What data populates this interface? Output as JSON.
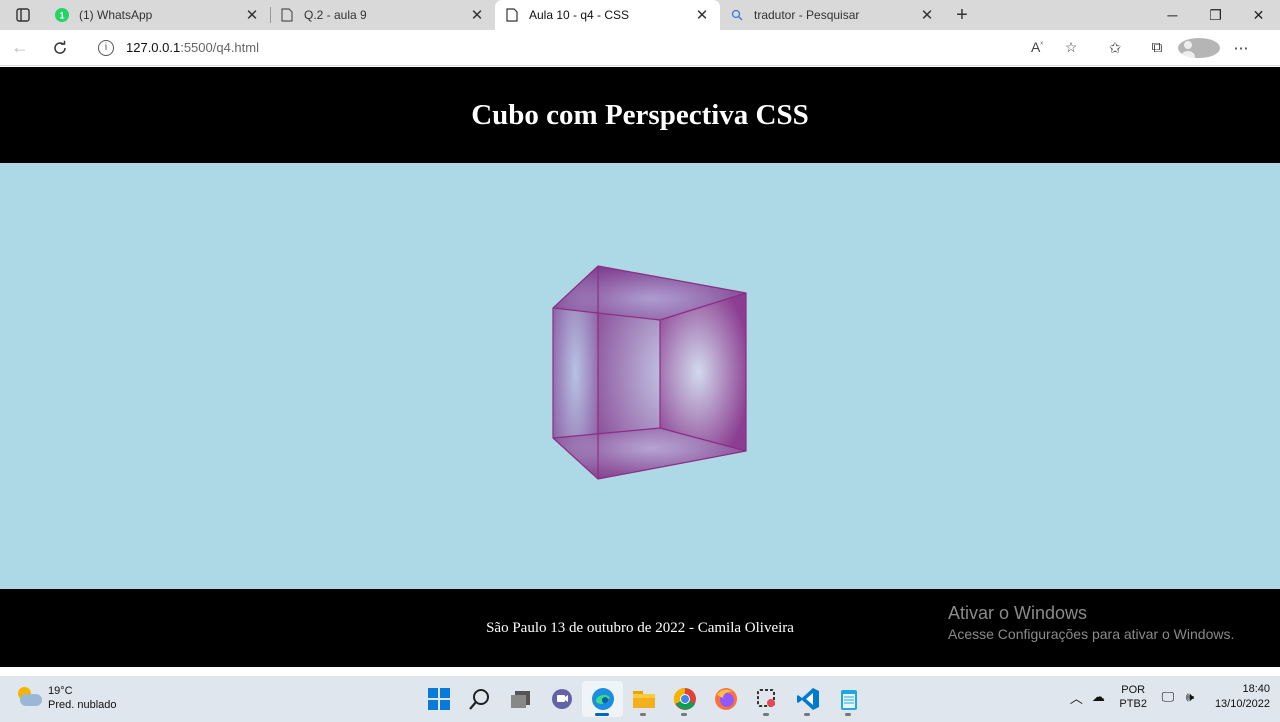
{
  "browser": {
    "tabs": [
      {
        "title": "(1) WhatsApp",
        "favicon": "whatsapp-icon",
        "favicon_badge": "1"
      },
      {
        "title": "Q.2 - aula 9",
        "favicon": "page-icon"
      },
      {
        "title": "Aula 10 - q4 - CSS",
        "favicon": "page-icon",
        "active": true
      },
      {
        "title": "tradutor - Pesquisar",
        "favicon": "search-icon"
      }
    ],
    "url_host": "127.0.0.1",
    "url_path": ":5500/q4.html"
  },
  "page": {
    "title": "Cubo com Perspectiva CSS",
    "footer_text": "São Paulo 13 de outubro de 2022 - Camila Oliveira",
    "colors": {
      "header_bg": "#000000",
      "stage_bg": "#add8e6",
      "cube": "#8b3a8f"
    }
  },
  "watermark": {
    "line1": "Ativar o Windows",
    "line2": "Acesse Configurações para ativar o Windows."
  },
  "taskbar": {
    "temperature": "19°C",
    "weather": "Pred. nublado",
    "lang": "POR",
    "layout": "PTB2",
    "time": "18:40",
    "date": "13/10/2022",
    "apps": [
      "start-icon",
      "search-icon",
      "task-view-icon",
      "teams-chat-icon",
      "edge-icon",
      "file-explorer-icon",
      "chrome-icon",
      "firefox-icon",
      "snipping-tool-icon",
      "vscode-icon",
      "notepad-icon"
    ]
  }
}
